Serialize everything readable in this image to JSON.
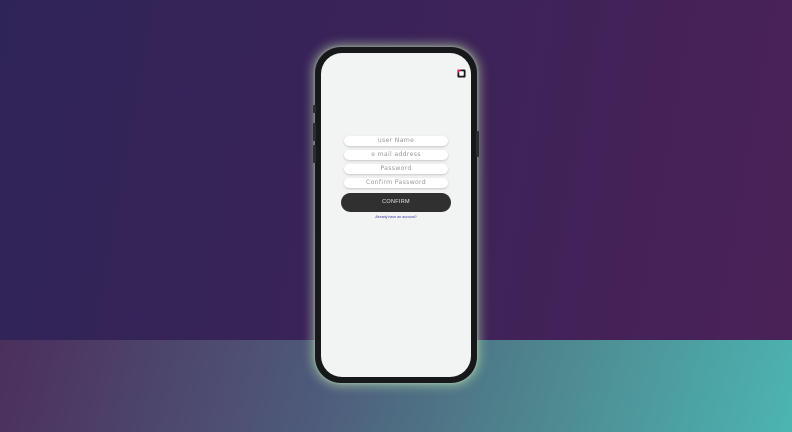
{
  "signup": {
    "username_placeholder": "user Name",
    "email_placeholder": "e mail address",
    "password_placeholder": "Password",
    "confirm_password_placeholder": "Confirm Password",
    "confirm_label": "CONFIRM",
    "login_link": "Already have an account?"
  },
  "colors": {
    "background_top": "#2f2458",
    "background_bottom": "#4cb5b2",
    "screen": "#f2f3f3",
    "button": "#2f302f",
    "logo_accent": "#e0245e"
  },
  "icons": {
    "logo": "app-logo-icon"
  }
}
